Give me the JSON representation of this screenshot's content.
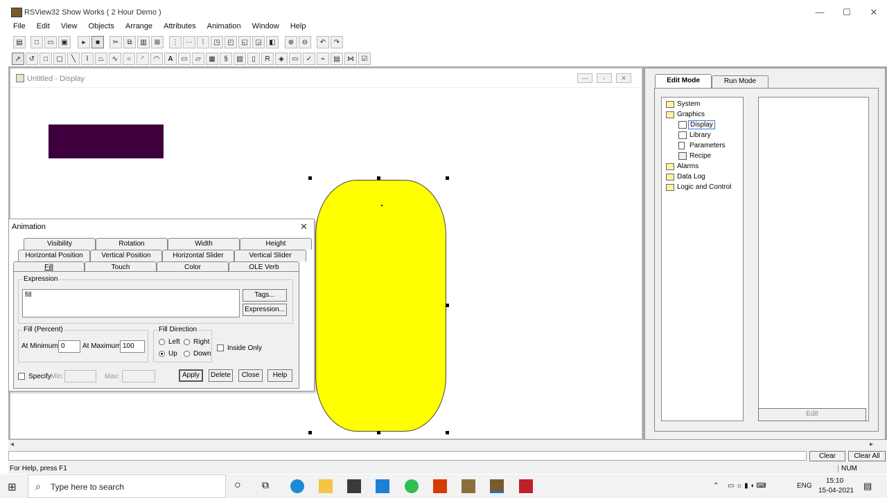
{
  "window": {
    "title": "RSView32 Show Works ( 2 Hour Demo )",
    "min": "—",
    "max": "☐",
    "close": "✕"
  },
  "menu": [
    "File",
    "Edit",
    "View",
    "Objects",
    "Arrange",
    "Attributes",
    "Animation",
    "Window",
    "Help"
  ],
  "display": {
    "title": "Untitled - Display"
  },
  "animation": {
    "title": "Animation",
    "tabs_row1": [
      "Visibility",
      "Rotation",
      "Width",
      "Height"
    ],
    "tabs_row2": [
      "Horizontal Position",
      "Vertical Position",
      "Horizontal Slider",
      "Vertical Slider"
    ],
    "tabs_row3": [
      "Fill",
      "Touch",
      "Color",
      "OLE Verb"
    ],
    "expression_label": "Expression",
    "expression_value": "fill",
    "tags_button": "Tags...",
    "expression_button": "Expression...",
    "fill_percent_label": "Fill (Percent)",
    "at_minimum_label": "At Minimum:",
    "at_minimum_value": "0",
    "at_maximum_label": "At Maximum:",
    "at_maximum_value": "100",
    "fill_direction_label": "Fill Direction",
    "dir_left": "Left",
    "dir_right": "Right",
    "dir_up": "Up",
    "dir_down": "Down",
    "inside_only": "Inside Only",
    "specify_label": "Specify",
    "min_label": "Min:",
    "max_label": "Max:",
    "apply": "Apply",
    "delete": "Delete",
    "close": "Close",
    "help": "Help"
  },
  "side": {
    "edit_mode": "Edit Mode",
    "run_mode": "Run Mode",
    "tree": [
      "System",
      "Graphics",
      "Display",
      "Library",
      "Parameters",
      "Recipe",
      "Alarms",
      "Data Log",
      "Logic and Control"
    ],
    "edit_button": "Edit"
  },
  "status": {
    "help_text": "For Help, press F1",
    "clear": "Clear",
    "clear_all": "Clear All",
    "num": "NUM"
  },
  "taskbar": {
    "search_placeholder": "Type here to search",
    "lang": "ENG",
    "time": "15:10",
    "date": "15-04-2021"
  },
  "colors": {
    "purple_rect": "#3d003d",
    "yellow_shape": "#ffff00"
  }
}
